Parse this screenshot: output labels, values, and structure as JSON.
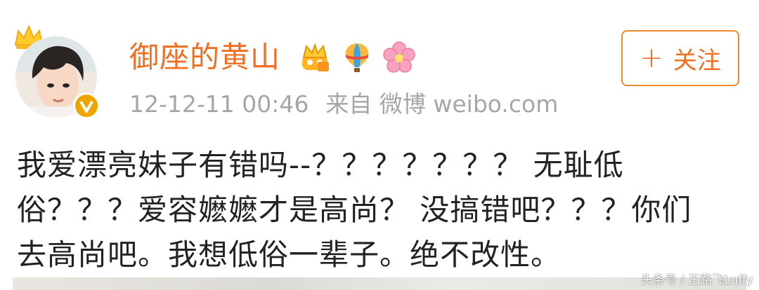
{
  "post": {
    "username": "御座的黄山",
    "meta": {
      "timestamp": "12-12-11 00:46",
      "source": "来自 微博 weibo.com"
    },
    "follow_button": {
      "plus": "+",
      "label": "关注"
    },
    "text_lines": [
      "我爱漂亮妹子有错吗--？？？？？？？ 无耻低",
      "俗？？？爱容嬷嬷才是高尚？ 没搞错吧？？？你们",
      "去高尚吧。我想低俗一辈子。绝不改性。"
    ],
    "badges": [
      "vip-crown-badge",
      "hot-air-balloon-badge",
      "cherry-blossom-badge"
    ],
    "avatar_decoration": "crown-icon",
    "verified_icon": "verified-v-icon"
  },
  "watermark": "头条号 / 王路飞Luffy",
  "colors": {
    "username": "#f26f21",
    "follow_border": "#f08a2c",
    "meta": "#a6a6a6",
    "text": "#222222",
    "verified": "#f0a400"
  }
}
